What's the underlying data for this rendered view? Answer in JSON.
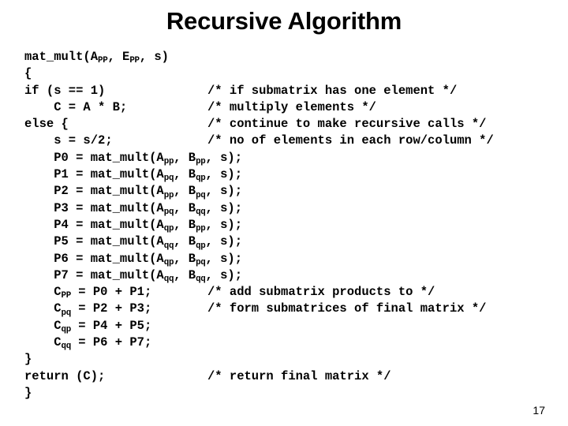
{
  "slide": {
    "title": "Recursive Algorithm",
    "number": "17",
    "background_color": "#ffffff",
    "text_color": "#000000"
  },
  "code": {
    "language": "c-pseudocode",
    "lines": [
      {
        "id": "line-signature",
        "indent": 0,
        "text": "mat_mult(A",
        "sub1": "PP",
        "mid": ", E",
        "sub2": "PP",
        "tail": ", s)",
        "comment": ""
      },
      {
        "id": "line-open-brace",
        "indent": 0,
        "text": "{",
        "comment": ""
      },
      {
        "id": "line-if",
        "indent": 0,
        "text": "if (s == 1)",
        "comment": "/* if submatrix has one element */"
      },
      {
        "id": "line-c-eq-ab",
        "indent": 1,
        "text": "C = A * B;",
        "comment": "/* multiply elements */"
      },
      {
        "id": "line-else",
        "indent": 0,
        "text": "else {",
        "comment": "/* continue to make recursive calls */"
      },
      {
        "id": "line-s-halve",
        "indent": 1,
        "text": "s = s/2;",
        "comment": "/* no of elements in each row/column */"
      },
      {
        "id": "line-p0",
        "indent": 1,
        "text": "P0 = mat_mult(A",
        "sub1": "pp",
        "mid": ", B",
        "sub2": "pp",
        "tail": ", s);",
        "comment": ""
      },
      {
        "id": "line-p1",
        "indent": 1,
        "text": "P1 = mat_mult(A",
        "sub1": "pq",
        "mid": ", B",
        "sub2": "qp",
        "tail": ", s);",
        "comment": ""
      },
      {
        "id": "line-p2",
        "indent": 1,
        "text": "P2 = mat_mult(A",
        "sub1": "pp",
        "mid": ", B",
        "sub2": "pq",
        "tail": ", s);",
        "comment": ""
      },
      {
        "id": "line-p3",
        "indent": 1,
        "text": "P3 = mat_mult(A",
        "sub1": "pq",
        "mid": ", B",
        "sub2": "qq",
        "tail": ", s);",
        "comment": ""
      },
      {
        "id": "line-p4",
        "indent": 1,
        "text": "P4 = mat_mult(A",
        "sub1": "qp",
        "mid": ", B",
        "sub2": "pp",
        "tail": ", s);",
        "comment": ""
      },
      {
        "id": "line-p5",
        "indent": 1,
        "text": "P5 = mat_mult(A",
        "sub1": "qq",
        "mid": ", B",
        "sub2": "qp",
        "tail": ", s);",
        "comment": ""
      },
      {
        "id": "line-p6",
        "indent": 1,
        "text": "P6 = mat_mult(A",
        "sub1": "qp",
        "mid": ", B",
        "sub2": "pq",
        "tail": ", s);",
        "comment": ""
      },
      {
        "id": "line-p7",
        "indent": 1,
        "text": "P7 = mat_mult(A",
        "sub1": "qq",
        "mid": ", B",
        "sub2": "qq",
        "tail": ", s);",
        "comment": ""
      },
      {
        "id": "line-cpp",
        "indent": 1,
        "text": "C",
        "sub1": "PP",
        "mid": " = P0 + P1;",
        "comment": "/* add submatrix products to */"
      },
      {
        "id": "line-cpq",
        "indent": 1,
        "text": "C",
        "sub1": "pq",
        "mid": " = P2 + P3;",
        "comment": "/* form submatrices of final matrix */"
      },
      {
        "id": "line-cqp",
        "indent": 1,
        "text": "C",
        "sub1": "qp",
        "mid": " = P4 + P5;",
        "comment": ""
      },
      {
        "id": "line-cqq",
        "indent": 1,
        "text": "C",
        "sub1": "qq",
        "mid": " = P6 + P7;",
        "comment": ""
      },
      {
        "id": "line-close-else",
        "indent": 0,
        "text": "}",
        "comment": ""
      },
      {
        "id": "line-return",
        "indent": 0,
        "text": "return (C);",
        "comment": "/* return final matrix */"
      },
      {
        "id": "line-close-func",
        "indent": 0,
        "text": "}",
        "comment": ""
      }
    ]
  }
}
